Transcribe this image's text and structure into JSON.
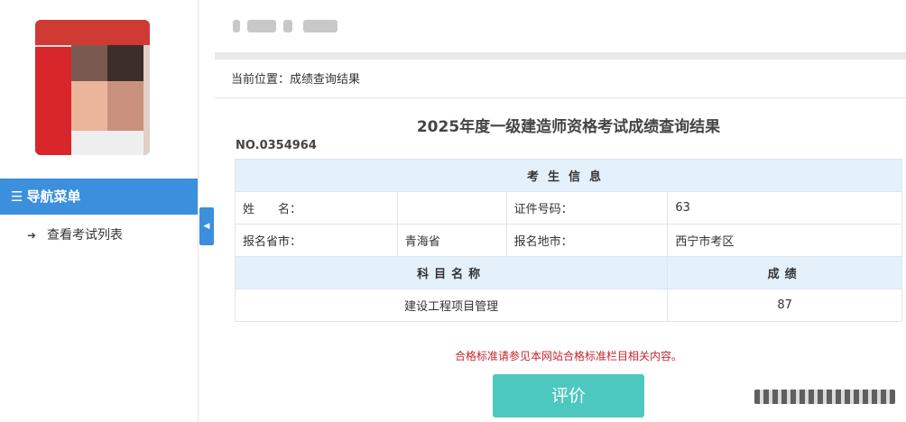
{
  "sidebar": {
    "nav_header_icon": "hamburger-icon",
    "nav_header_label": "导航菜单",
    "items": [
      {
        "label": "查看考试列表",
        "icon": "sign-in-arrow-icon"
      }
    ],
    "collapse_icon": "caret-left-icon"
  },
  "breadcrumb": "当前位置：成绩查询结果",
  "page_title": "2025年度一级建造师资格考试成绩查询结果",
  "serial_no": "NO.0354964",
  "candidate": {
    "section_title": "考生信息",
    "name_label": "姓　　名：",
    "name_value": "",
    "id_label": "证件号码：",
    "id_value": "63",
    "province_label": "报名省市：",
    "province_value": "青海省",
    "city_label": "报名地市：",
    "city_value": "西宁市考区"
  },
  "scores": {
    "subject_header": "科目名称",
    "score_header": "成绩",
    "rows": [
      {
        "subject": "建设工程项目管理",
        "score": "87"
      }
    ]
  },
  "note": "合格标准请参见本网站合格标准栏目相关内容。",
  "eval_button": "评价",
  "colors": {
    "accent_blue": "#3b8fdc",
    "table_header": "#e4f1fb",
    "note_red": "#c0282d",
    "button_teal": "#4cc8c0"
  }
}
